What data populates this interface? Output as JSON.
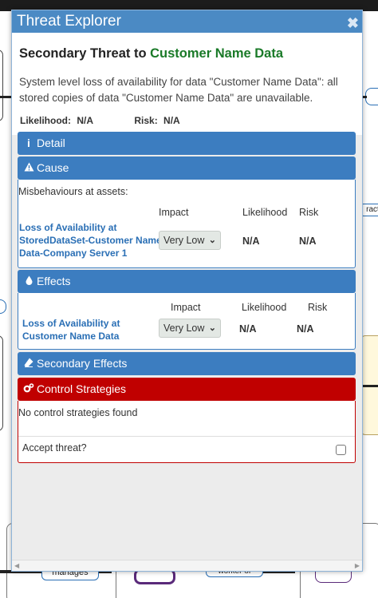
{
  "window": {
    "title": "Threat Explorer",
    "close_glyph": "✖"
  },
  "threat": {
    "heading_prefix": "Secondary Threat to",
    "heading_asset": "Customer Name Data",
    "description": "System level loss of availability for data \"Customer Name Data\": all stored copies of data \"Customer Name Data\" are unavailable.",
    "likelihood_label": "Likelihood:",
    "likelihood_value": "N/A",
    "risk_label": "Risk:",
    "risk_value": "N/A"
  },
  "detail": {
    "label": "Detail",
    "icon": "info-icon"
  },
  "cause": {
    "label": "Cause",
    "icon": "warning-icon",
    "intro": "Misbehaviours at assets:",
    "columns": {
      "impact": "Impact",
      "likelihood": "Likelihood",
      "risk": "Risk"
    },
    "rows": [
      {
        "name": "Loss of Availability at StoredDataSet-Customer Name Data-Company Server 1",
        "name_lines": [
          "Loss of Availability at",
          "StoredDataSet-Customer Name",
          "Data-Company Server 1"
        ],
        "impact": "Very Low",
        "likelihood": "N/A",
        "risk": "N/A"
      }
    ]
  },
  "effects": {
    "label": "Effects",
    "icon": "droplet-icon",
    "columns": {
      "impact": "Impact",
      "likelihood": "Likelihood",
      "risk": "Risk"
    },
    "rows": [
      {
        "name": "Loss of Availability at Customer Name Data",
        "name_lines": [
          "Loss of Availability at",
          "Customer Name Data"
        ],
        "impact": "Very Low",
        "likelihood": "N/A",
        "risk": "N/A"
      }
    ]
  },
  "secondary_effects": {
    "label": "Secondary Effects",
    "icon": "eraser-icon"
  },
  "control_strategies": {
    "label": "Control Strategies",
    "icon": "gears-icon",
    "empty_text": "No control strategies found",
    "accept_label": "Accept threat?",
    "accept_checked": false
  },
  "background": {
    "labels": {
      "manages": "manages",
      "worker_of": "worker of",
      "interacts": "racts"
    }
  },
  "colors": {
    "title_bar": "#4b8ac4",
    "panel_blue": "#3c7dc0",
    "panel_red": "#c00000",
    "asset_green": "#1a7a28",
    "link_blue": "#2a6fb5"
  }
}
